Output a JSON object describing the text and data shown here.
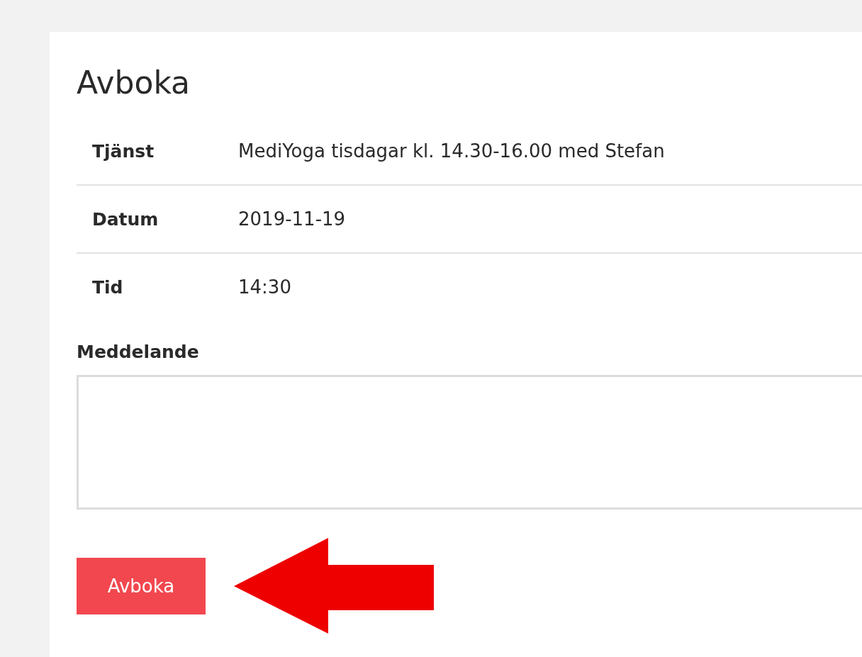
{
  "title": "Avboka",
  "details": [
    {
      "label": "Tjänst",
      "value": "MediYoga tisdagar kl. 14.30-16.00 med Stefan"
    },
    {
      "label": "Datum",
      "value": "2019-11-19"
    },
    {
      "label": "Tid",
      "value": "14:30"
    }
  ],
  "message": {
    "label": "Meddelande"
  },
  "submit_button": "Avboka",
  "annotation_arrow": true
}
